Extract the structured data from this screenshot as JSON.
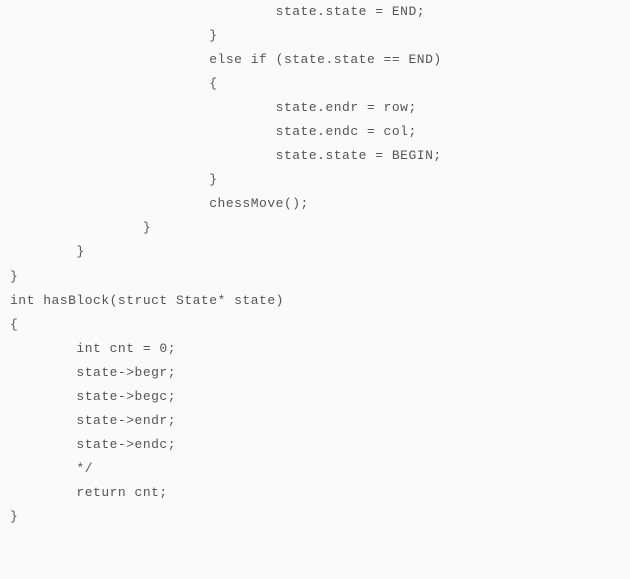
{
  "code": {
    "lines": [
      "                                state.state = END;",
      "                        }",
      "                        else if (state.state == END)",
      "                        {",
      "                                state.endr = row;",
      "                                state.endc = col;",
      "                                state.state = BEGIN;",
      "                        }",
      "                        chessMove();",
      "                }",
      "        }",
      "}",
      "int hasBlock(struct State* state)",
      "{",
      "        int cnt = 0;",
      "        state->begr;",
      "        state->begc;",
      "        state->endr;",
      "        state->endc;",
      "",
      "",
      "        */",
      "",
      "        return cnt;",
      "}"
    ]
  }
}
